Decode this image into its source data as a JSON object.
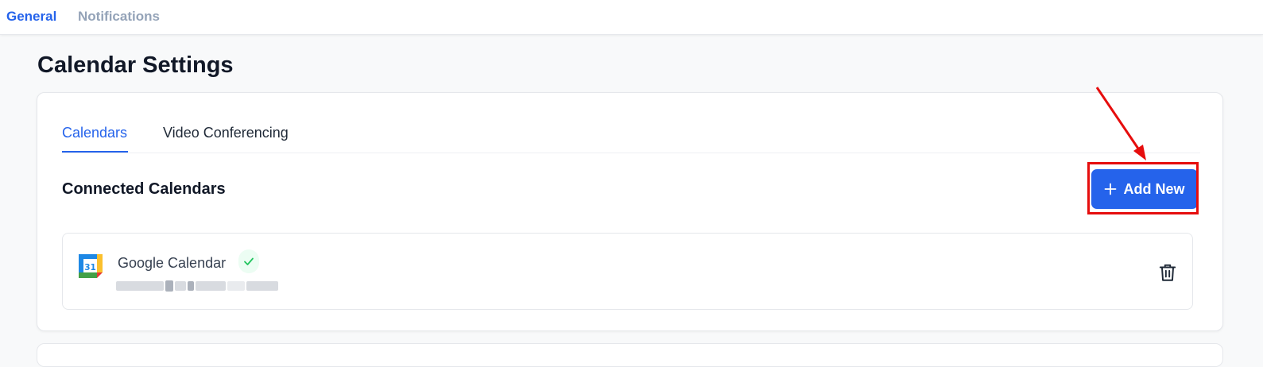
{
  "top_nav": {
    "tabs": [
      {
        "label": "General",
        "active": true
      },
      {
        "label": "Notifications",
        "active": false
      }
    ]
  },
  "page": {
    "title": "Calendar Settings"
  },
  "card": {
    "tabs": [
      {
        "label": "Calendars",
        "active": true
      },
      {
        "label": "Video Conferencing",
        "active": false
      }
    ],
    "section_title": "Connected Calendars",
    "add_button": {
      "icon": "plus-icon",
      "label": "Add New"
    },
    "calendars": [
      {
        "icon": "google-calendar-icon",
        "icon_day": "31",
        "name": "Google Calendar",
        "connected": true,
        "status_icon": "check-icon",
        "action_icon": "trash-icon"
      }
    ]
  },
  "colors": {
    "accent": "#2563eb",
    "annotation": "#e60d0d",
    "success": "#22c55e"
  }
}
